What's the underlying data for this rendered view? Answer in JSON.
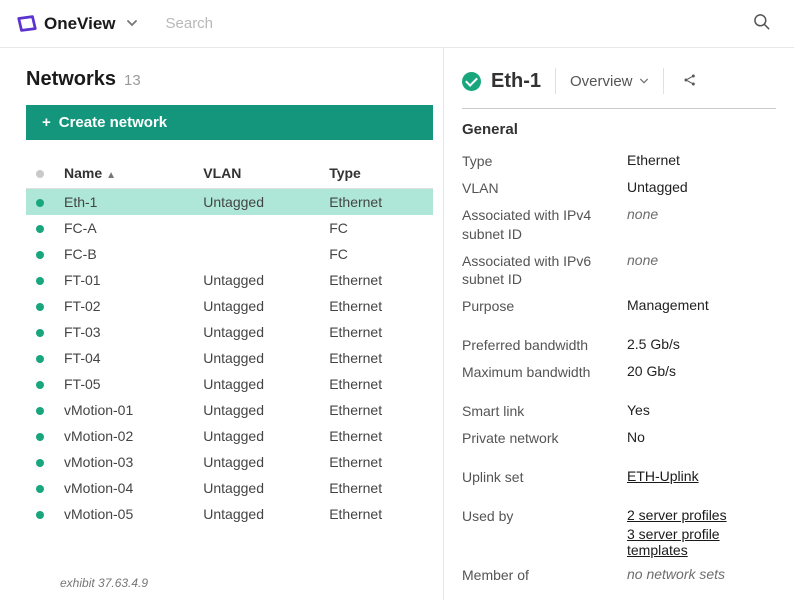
{
  "app": {
    "name": "OneView",
    "search_placeholder": "Search"
  },
  "page": {
    "title": "Networks",
    "count": 13,
    "create_label": "Create network",
    "exhibit": "exhibit 37.63.4.9"
  },
  "table": {
    "headers": {
      "status": "",
      "name": "Name",
      "vlan": "VLAN",
      "type": "Type"
    },
    "rows": [
      {
        "name": "Eth-1",
        "vlan": "Untagged",
        "type": "Ethernet",
        "selected": true
      },
      {
        "name": "FC-A",
        "vlan": "",
        "type": "FC"
      },
      {
        "name": "FC-B",
        "vlan": "",
        "type": "FC"
      },
      {
        "name": "FT-01",
        "vlan": "Untagged",
        "type": "Ethernet"
      },
      {
        "name": "FT-02",
        "vlan": "Untagged",
        "type": "Ethernet"
      },
      {
        "name": "FT-03",
        "vlan": "Untagged",
        "type": "Ethernet"
      },
      {
        "name": "FT-04",
        "vlan": "Untagged",
        "type": "Ethernet"
      },
      {
        "name": "FT-05",
        "vlan": "Untagged",
        "type": "Ethernet"
      },
      {
        "name": "vMotion-01",
        "vlan": "Untagged",
        "type": "Ethernet"
      },
      {
        "name": "vMotion-02",
        "vlan": "Untagged",
        "type": "Ethernet"
      },
      {
        "name": "vMotion-03",
        "vlan": "Untagged",
        "type": "Ethernet"
      },
      {
        "name": "vMotion-04",
        "vlan": "Untagged",
        "type": "Ethernet"
      },
      {
        "name": "vMotion-05",
        "vlan": "Untagged",
        "type": "Ethernet"
      }
    ]
  },
  "detail": {
    "title": "Eth-1",
    "view_label": "Overview",
    "section": "General",
    "props": {
      "type_label": "Type",
      "type_value": "Ethernet",
      "vlan_label": "VLAN",
      "vlan_value": "Untagged",
      "ipv4_label": "Associated with IPv4 subnet ID",
      "ipv4_value": "none",
      "ipv6_label": "Associated with IPv6 subnet ID",
      "ipv6_value": "none",
      "purpose_label": "Purpose",
      "purpose_value": "Management",
      "pref_bw_label": "Preferred bandwidth",
      "pref_bw_value": "2.5 Gb/s",
      "max_bw_label": "Maximum bandwidth",
      "max_bw_value": "20 Gb/s",
      "smart_link_label": "Smart link",
      "smart_link_value": "Yes",
      "private_label": "Private network",
      "private_value": "No",
      "uplink_label": "Uplink set",
      "uplink_value": "ETH-Uplink",
      "used_by_label": "Used by",
      "used_by_1": "2 server profiles",
      "used_by_2": "3 server profile templates",
      "member_of_label": "Member of",
      "member_of_value": "no network sets"
    }
  }
}
